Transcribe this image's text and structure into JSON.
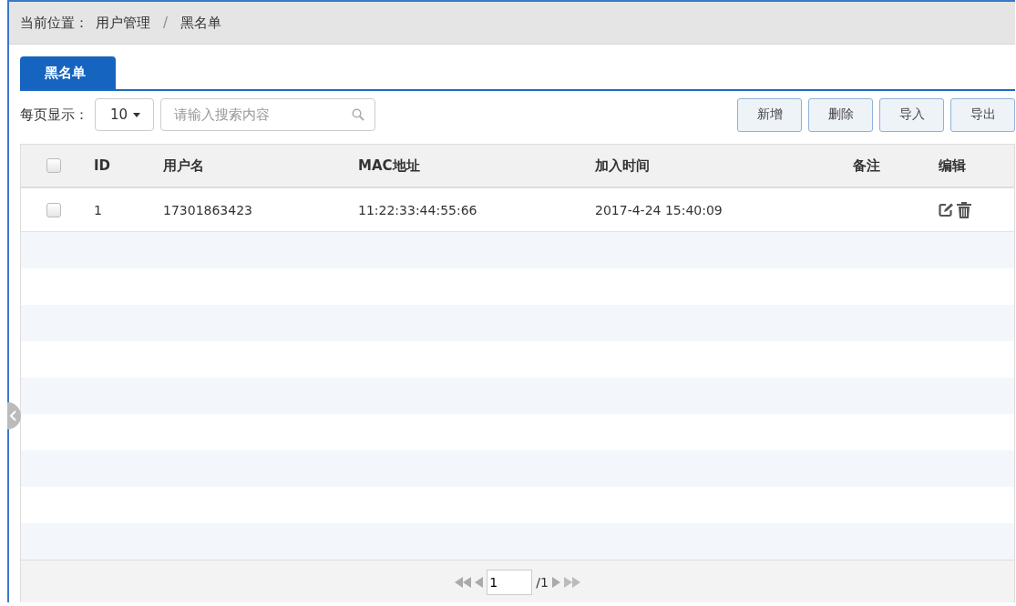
{
  "breadcrumb": {
    "label": "当前位置：",
    "items": [
      "用户管理",
      "黑名单"
    ],
    "separator": "/"
  },
  "tabs": [
    {
      "label": "黑名单",
      "selected": true
    }
  ],
  "toolbar": {
    "page_size_label": "每页显示：",
    "page_size": "10",
    "search": {
      "placeholder": "请输入搜索内容"
    },
    "buttons": [
      "新增",
      "删除",
      "导入",
      "导出"
    ]
  },
  "table": {
    "select_all": {
      "checked": false
    },
    "columns": [
      "ID",
      "用户名",
      "MAC地址",
      "加入时间",
      "备注",
      "编辑"
    ],
    "rows": [
      {
        "checked": false,
        "cells": [
          "1",
          "17301863423",
          "11:22:33:44:55:66",
          "2017-4-24 15:40:09",
          ""
        ]
      }
    ]
  },
  "pager": {
    "page": "1",
    "total": "/1"
  }
}
